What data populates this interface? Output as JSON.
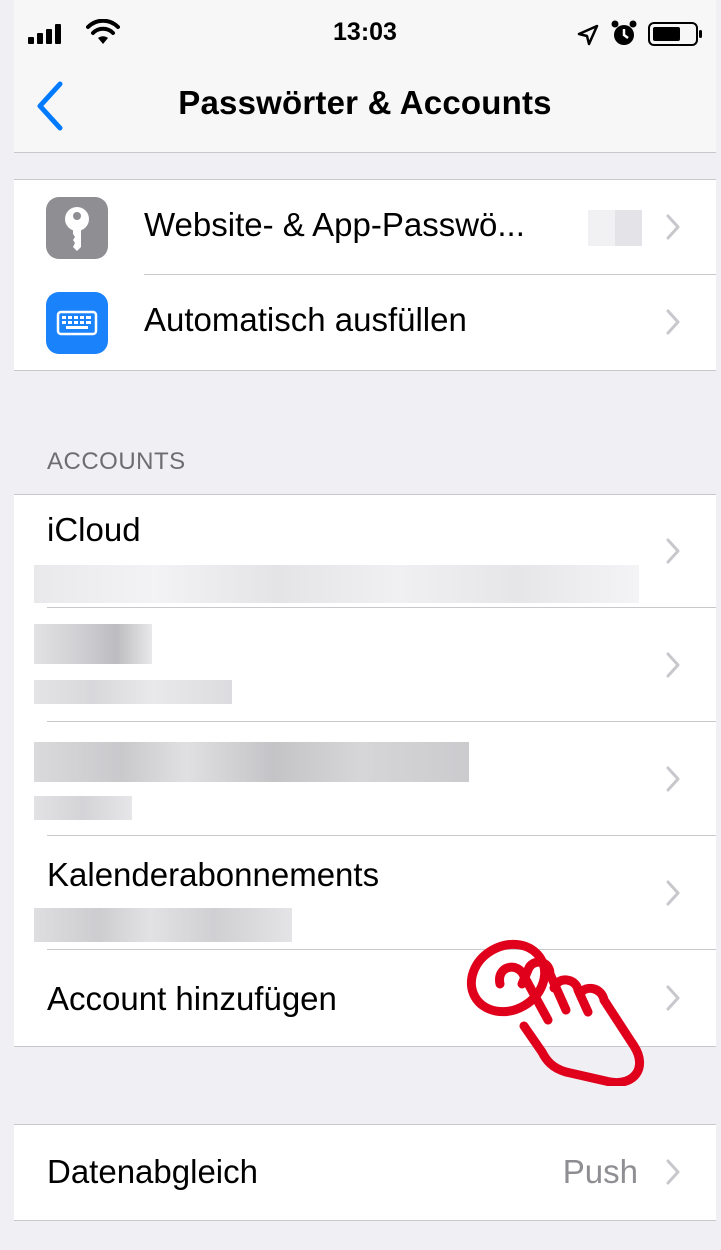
{
  "status_bar": {
    "time": "13:03",
    "icons": [
      "signal-icon",
      "wifi-icon",
      "location-icon",
      "alarm-icon",
      "battery-icon"
    ]
  },
  "nav": {
    "title": "Passwörter & Accounts",
    "back_icon": "chevron-left-icon"
  },
  "top_group": {
    "items": [
      {
        "label": "Website- & App-Passwö...",
        "icon": "key-icon",
        "icon_color": "#8e8e93"
      },
      {
        "label": "Automatisch ausfüllen",
        "icon": "keyboard-icon",
        "icon_color": "#1a82fb"
      }
    ]
  },
  "accounts": {
    "header": "ACCOUNTS",
    "items": [
      {
        "label": "iCloud"
      },
      {
        "label": ""
      },
      {
        "label": ""
      },
      {
        "label": "Kalenderabonnements"
      },
      {
        "label": "Account hinzufügen"
      }
    ]
  },
  "fetch": {
    "label": "Datenabgleich",
    "value": "Push"
  },
  "colors": {
    "accent": "#007aff",
    "background": "#efeff4",
    "hand_overlay": "#e0001b"
  }
}
